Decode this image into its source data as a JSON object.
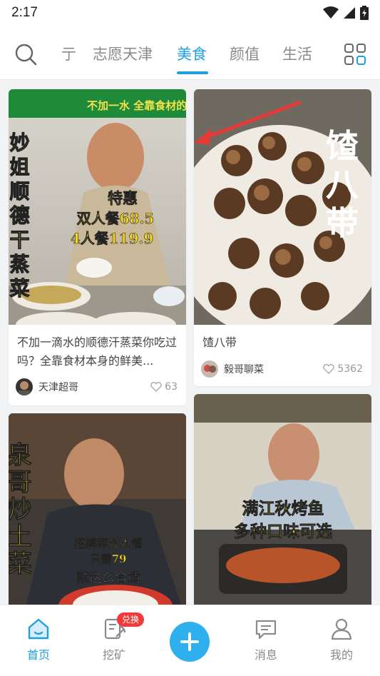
{
  "status_bar": {
    "time": "2:17"
  },
  "nav_tabs": [
    {
      "label": "亍",
      "active": false
    },
    {
      "label": "志愿天津",
      "active": false
    },
    {
      "label": "美食",
      "active": true
    },
    {
      "label": "颜值",
      "active": false
    },
    {
      "label": "生活",
      "active": false
    }
  ],
  "feed": [
    {
      "title": "不加一滴水的顺德汗蒸菜你吃过吗？全靠食材本身的鲜美...",
      "author": "天津超哥",
      "likes": "63",
      "image": {
        "top_banner": "不加一水 全靠食材的鲜",
        "vertical_text": "妙姐顺德干蒸菜",
        "promo_line1": "特惠",
        "promo_line2": "双人餐68.5",
        "promo_line3": "4人餐119.9"
      }
    },
    {
      "title": "馇八带",
      "author": "毅哥聊菜",
      "likes": "5362",
      "image": {
        "overlay_text": "馇八带"
      }
    },
    {
      "title": "",
      "author": "",
      "likes": "",
      "image": {
        "vertical_text": "泉哥炒土菜",
        "promo_line1": "招牌菜双人餐",
        "promo_line2": "只需79",
        "promo_line3": "就这么合适"
      }
    },
    {
      "title": "",
      "author": "",
      "likes": "",
      "image": {
        "promo_line1": "满江秋烤鱼",
        "promo_line2": "多种口味可选"
      }
    }
  ],
  "bottom_nav": {
    "home": "首页",
    "mining": "挖矿",
    "mining_badge": "兑换",
    "messages": "消息",
    "profile": "我的"
  },
  "colors": {
    "accent": "#1e9fe0",
    "badge": "#f23a3a",
    "plus": "#2fb0ee"
  }
}
